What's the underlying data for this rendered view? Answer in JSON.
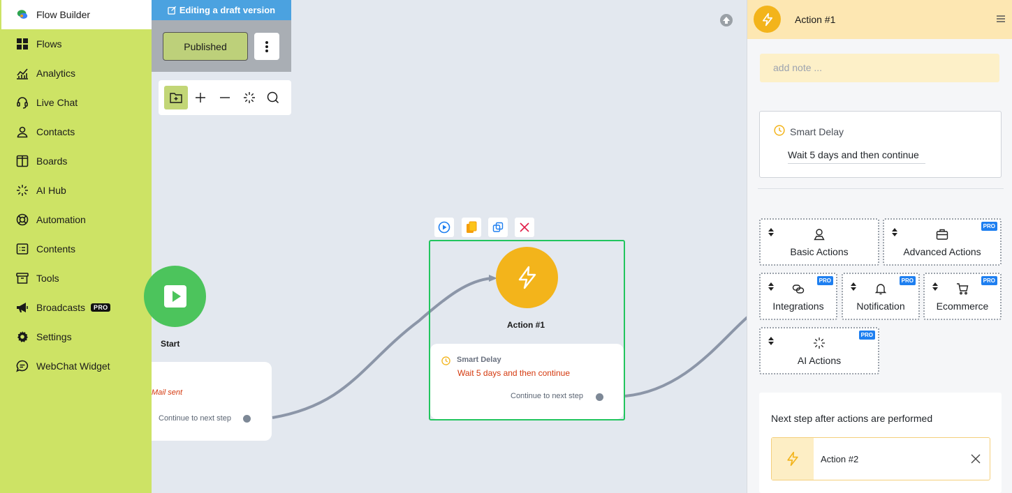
{
  "sidebar": {
    "items": [
      {
        "label": "Flow Builder",
        "icon": "chat-bubbles-icon"
      },
      {
        "label": "Flows",
        "icon": "grid-icon"
      },
      {
        "label": "Analytics",
        "icon": "analytics-icon"
      },
      {
        "label": "Live Chat",
        "icon": "headset-icon"
      },
      {
        "label": "Contacts",
        "icon": "user-icon"
      },
      {
        "label": "Boards",
        "icon": "board-icon"
      },
      {
        "label": "AI Hub",
        "icon": "sparkle-icon"
      },
      {
        "label": "Automation",
        "icon": "lifebuoy-icon"
      },
      {
        "label": "Contents",
        "icon": "contents-icon"
      },
      {
        "label": "Tools",
        "icon": "archive-icon"
      },
      {
        "label": "Broadcasts",
        "icon": "megaphone-icon",
        "badge": "PRO"
      },
      {
        "label": "Settings",
        "icon": "gear-icon"
      },
      {
        "label": "WebChat Widget",
        "icon": "chat-icon"
      }
    ],
    "active": "Flow Builder",
    "color": "#cde365"
  },
  "editor": {
    "banner": "Editing a draft version",
    "published_label": "Published"
  },
  "canvas": {
    "start": {
      "label": "Start",
      "mail_sent": "Mail sent",
      "continue": "Continue to next step"
    },
    "action": {
      "label": "Action #1",
      "delay_title": "Smart Delay",
      "delay_text": "Wait 5 days and then continue",
      "continue": "Continue to next step"
    }
  },
  "panel": {
    "title": "Action #1",
    "note_placeholder": "add note ...",
    "smart_delay": {
      "title": "Smart Delay",
      "value": "Wait 5 days and then continue"
    },
    "actions": [
      {
        "label": "Basic Actions",
        "pro": ""
      },
      {
        "label": "Advanced Actions",
        "pro": "PRO"
      },
      {
        "label": "Integrations",
        "pro": "PRO"
      },
      {
        "label": "Notification",
        "pro": "PRO"
      },
      {
        "label": "Ecommerce",
        "pro": "PRO"
      },
      {
        "label": "AI Actions",
        "pro": "PRO"
      }
    ],
    "next_step": {
      "title": "Next step after actions are performed",
      "item": "Action #2"
    }
  },
  "colors": {
    "accent": "#22c55e",
    "action": "#f3b41b",
    "start": "#4cc45c",
    "banner": "#4ba2e0",
    "pro": "#1e7ff0"
  }
}
